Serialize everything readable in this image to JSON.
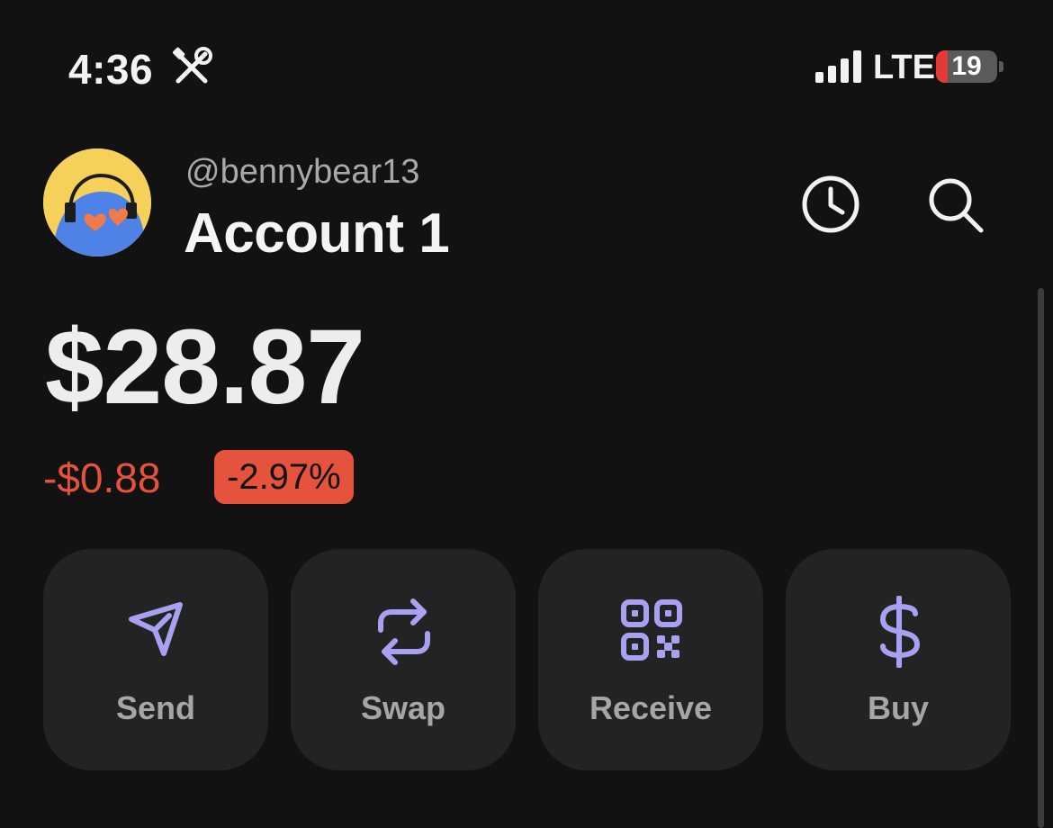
{
  "status_bar": {
    "time": "4:36",
    "network": "LTE",
    "battery_level": "19",
    "battery_fraction": 0.19,
    "battery_color": "#e53935"
  },
  "header": {
    "username": "@bennybear13",
    "account_name": "Account 1",
    "icons": [
      "clock-icon",
      "search-icon"
    ]
  },
  "balance": {
    "amount": "$28.87",
    "change_amount": "-$0.88",
    "change_percent": "-2.97%",
    "negative_color": "#e5533d"
  },
  "actions": [
    {
      "label": "Send",
      "icon": "send-icon"
    },
    {
      "label": "Swap",
      "icon": "swap-icon"
    },
    {
      "label": "Receive",
      "icon": "qr-code-icon"
    },
    {
      "label": "Buy",
      "icon": "dollar-icon"
    }
  ],
  "colors": {
    "background": "#121212",
    "card": "#232323",
    "accent": "#ab9ff2"
  }
}
